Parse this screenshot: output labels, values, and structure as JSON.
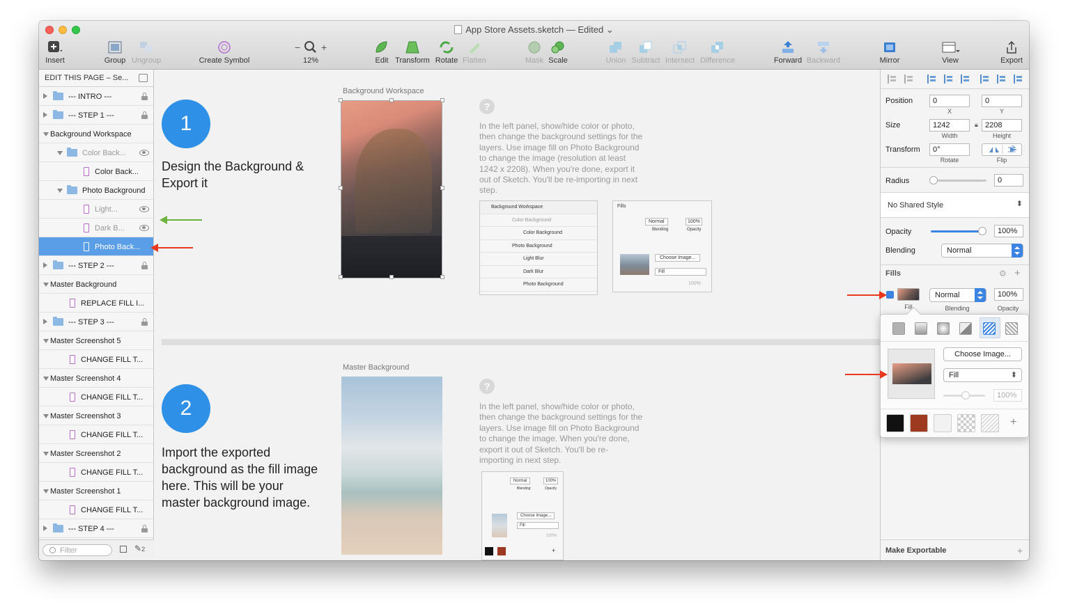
{
  "window": {
    "title": "App Store Assets.sketch — Edited"
  },
  "toolbar": {
    "insert": "Insert",
    "group": "Group",
    "ungroup": "Ungroup",
    "create_symbol": "Create Symbol",
    "zoom_minus": "−",
    "zoom_plus": "+",
    "zoom": "12%",
    "edit": "Edit",
    "transform": "Transform",
    "rotate": "Rotate",
    "flatten": "Flatten",
    "mask": "Mask",
    "scale": "Scale",
    "union": "Union",
    "subtract": "Subtract",
    "intersect": "Intersect",
    "difference": "Difference",
    "forward": "Forward",
    "backward": "Backward",
    "mirror": "Mirror",
    "view": "View",
    "export": "Export"
  },
  "sidebar": {
    "page": "EDIT THIS PAGE – Se...",
    "layers": [
      {
        "label": "--- INTRO ---",
        "kind": "folder",
        "state": "collapsed",
        "locked": true
      },
      {
        "label": "--- STEP 1 ---",
        "kind": "folder",
        "state": "collapsed",
        "locked": true
      },
      {
        "label": "Background Workspace",
        "kind": "artboard",
        "state": "expanded"
      },
      {
        "label": "Color Back...",
        "kind": "folder",
        "state": "expanded",
        "hidden": true
      },
      {
        "label": "Color Back...",
        "kind": "rect"
      },
      {
        "label": "Photo Background",
        "kind": "folder",
        "state": "expanded"
      },
      {
        "label": "Light...",
        "kind": "rect",
        "hidden": true
      },
      {
        "label": "Dark B...",
        "kind": "rect",
        "hidden": true
      },
      {
        "label": "Photo Back...",
        "kind": "rect",
        "selected": true
      },
      {
        "label": "--- STEP 2 ---",
        "kind": "folder",
        "state": "collapsed",
        "locked": true
      },
      {
        "label": "Master Background",
        "kind": "artboard",
        "state": "expanded"
      },
      {
        "label": "REPLACE FILL I...",
        "kind": "rect"
      },
      {
        "label": "--- STEP 3 ---",
        "kind": "folder",
        "state": "collapsed",
        "locked": true
      },
      {
        "label": "Master Screenshot 5",
        "kind": "artboard",
        "state": "expanded"
      },
      {
        "label": "CHANGE FILL T...",
        "kind": "rect"
      },
      {
        "label": "Master Screenshot 4",
        "kind": "artboard",
        "state": "expanded"
      },
      {
        "label": "CHANGE FILL T...",
        "kind": "rect"
      },
      {
        "label": "Master Screenshot 3",
        "kind": "artboard",
        "state": "expanded"
      },
      {
        "label": "CHANGE FILL T...",
        "kind": "rect"
      },
      {
        "label": "Master Screenshot 2",
        "kind": "artboard",
        "state": "expanded"
      },
      {
        "label": "CHANGE FILL T...",
        "kind": "rect"
      },
      {
        "label": "Master Screenshot 1",
        "kind": "artboard",
        "state": "expanded"
      },
      {
        "label": "CHANGE FILL T...",
        "kind": "rect"
      },
      {
        "label": "--- STEP 4 ---",
        "kind": "folder",
        "state": "collapsed",
        "locked": true
      }
    ],
    "filter_placeholder": "Filter",
    "brush_count": "2"
  },
  "canvas": {
    "step1": {
      "number": "1",
      "line1": "Design the Background &",
      "line2": "Export it",
      "artboard_label": "Background Workspace",
      "help": "?",
      "para": [
        "In the left panel, show/hide color or photo,",
        "then change the background settings for the",
        "layers. Use image fill on Photo Background",
        "to change the image (resolution at least",
        "1242 x 2208). When you're done, export it",
        "out of Sketch. You'll be re-importing in next",
        "step."
      ],
      "mini_layers": [
        "Background Workspace",
        "Color Background",
        "Color Background",
        "Photo Background",
        "Light Blur",
        "Dark Blur",
        "Photo Background"
      ],
      "mini_fills": {
        "title": "Fills",
        "blend": "Normal",
        "opacity": "100%",
        "blend_sub": "Blending",
        "opacity_sub": "Opacity",
        "choose": "Choose Image...",
        "mode": "Fill",
        "pct": "100%"
      }
    },
    "step2": {
      "number": "2",
      "line1": "Import the exported",
      "line2": "background as the fill image",
      "line3": "here. This will be your",
      "line4": "master background image.",
      "artboard_label": "Master Background",
      "help": "?",
      "para": [
        "In the left panel, show/hide color or photo,",
        "then change the background settings for the",
        "layers. Use image fill on Photo Background",
        "to change the image. When you're done,",
        "export it out of Sketch. You'll be re-",
        "importing in next step."
      ],
      "mini": {
        "blend": "Normal",
        "opacity": "100%",
        "blend_sub": "Blending",
        "opacity_sub": "Opacity",
        "choose": "Choose Image...",
        "mode": "Fill",
        "pct": "100%",
        "plus": "+"
      }
    }
  },
  "inspector": {
    "position": {
      "label": "Position",
      "x": "0",
      "y": "0",
      "x_sub": "X",
      "y_sub": "Y"
    },
    "size": {
      "label": "Size",
      "w": "1242",
      "h": "2208",
      "w_sub": "Width",
      "h_sub": "Height"
    },
    "transform": {
      "label": "Transform",
      "rotate": "0°",
      "rotate_sub": "Rotate",
      "flip_sub": "Flip"
    },
    "radius": {
      "label": "Radius",
      "value": "0"
    },
    "shared_style": "No Shared Style",
    "opacity": {
      "label": "Opacity",
      "value": "100%",
      "level": 1.0
    },
    "blending": {
      "label": "Blending",
      "value": "Normal"
    },
    "fills": {
      "label": "Fills",
      "blend": "Normal",
      "opacity": "100%",
      "fill_sub": "Fill",
      "blend_sub": "Blending",
      "opacity_sub": "Opacity",
      "add": "+"
    },
    "fill_popover": {
      "choose": "Choose Image...",
      "mode": "Fill",
      "pct": "100%",
      "add": "+"
    },
    "make_exportable": "Make Exportable",
    "make_exportable_add": "+"
  },
  "colors": {
    "accent": "#2e91e7",
    "selection": "#5b9ee8",
    "arrow_red": "#e8391e",
    "arrow_green": "#6cb33e",
    "swatch_black": "#111111",
    "swatch_rust": "#9e3a20"
  }
}
